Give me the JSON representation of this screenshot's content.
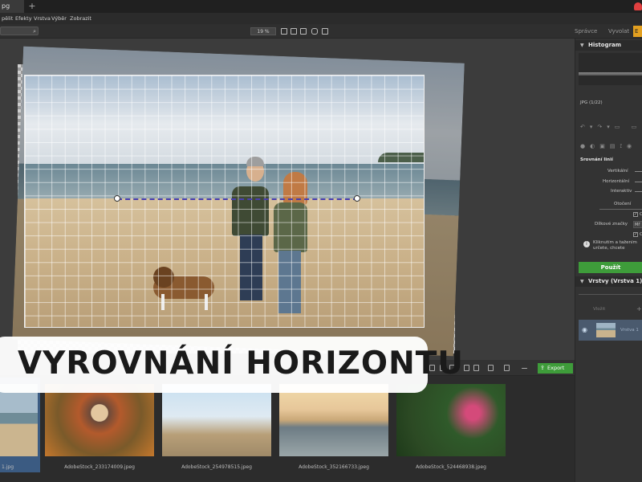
{
  "titlebar": {
    "tab_label": "pg",
    "new_tab": "+"
  },
  "menubar": {
    "items": [
      "pělit",
      "Efekty",
      "Vrstva",
      "Výběr",
      "Zobrazit"
    ]
  },
  "toolbar": {
    "zoom": "19 %",
    "search_icon": "search-icon"
  },
  "modes": {
    "manage": "Správce",
    "develop": "Vyvolat",
    "edit": "E"
  },
  "right_panel": {
    "histogram_title": "Histogram",
    "file_info": "JPG (1/22)",
    "straighten_title": "Srovnání linií",
    "options": [
      "Vertikální",
      "Horizontální",
      "Interaktiv"
    ],
    "rotation_label": "Otočení",
    "guides_label": "Dílkové značky",
    "guides_value": "Mř",
    "check_a": "C",
    "check_b": "C",
    "hint": "Kliknutím a tažením určete, chcete narovnat.",
    "apply_label": "Použít",
    "layers_title": "Vrstvy (Vrstva 1)",
    "layer_btn": "Vložit",
    "layer_name": "Vrstva 1"
  },
  "filmstrip": {
    "export_label": "Export",
    "thumbnails": [
      {
        "label": "1.jpg"
      },
      {
        "label": "AdobeStock_233174009.jpeg"
      },
      {
        "label": "AdobeStock_254978515.jpeg"
      },
      {
        "label": "AdobeStock_352166733.jpeg"
      },
      {
        "label": "AdobeStock_524468938.jpeg"
      }
    ]
  },
  "overlay": {
    "title": "VYROVNÁNÍ HORIZONTU"
  },
  "colors": {
    "accent_green": "#3e9c3a",
    "accent_orange": "#e3a020",
    "horizon_line": "#4a3fb0"
  }
}
